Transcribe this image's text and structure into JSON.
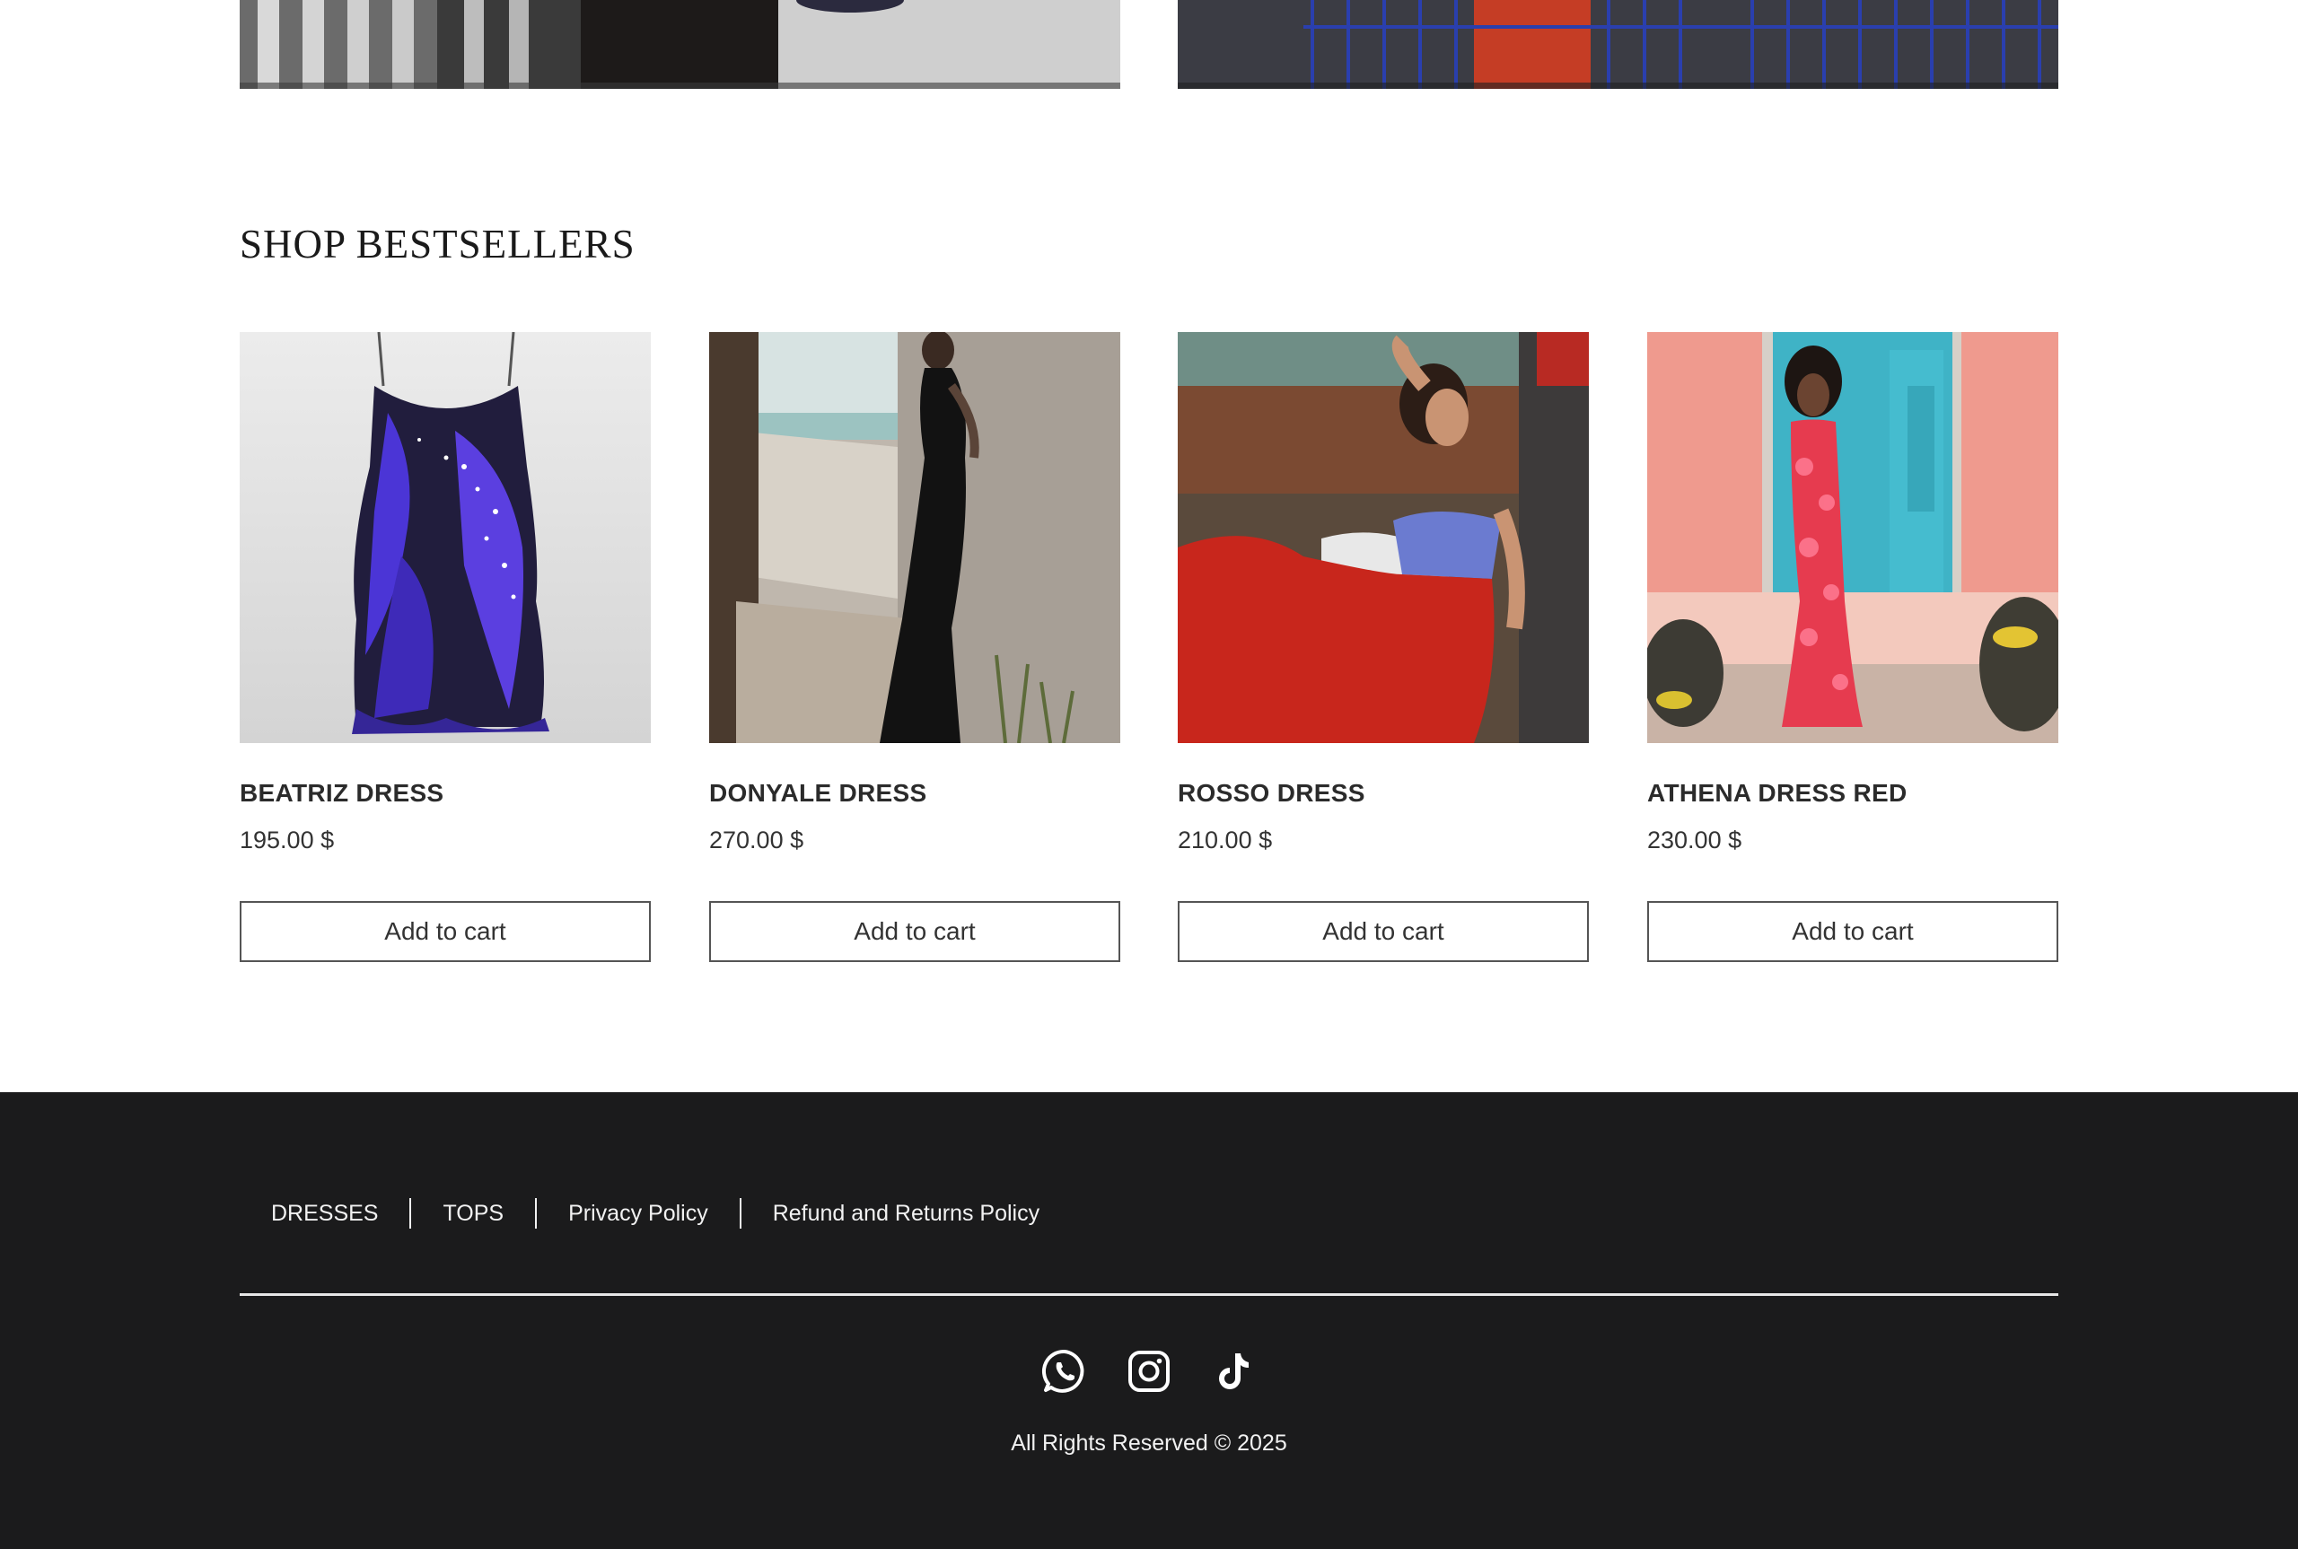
{
  "section": {
    "title": "SHOP BESTSELLERS"
  },
  "products": [
    {
      "name": "BEATRIZ DRESS",
      "price": "195.00 $",
      "cta": "Add to cart",
      "image": "purple-butterfly-print-mini-dress"
    },
    {
      "name": "DONYALE DRESS",
      "price": "270.00 $",
      "cta": "Add to cart",
      "image": "black-halter-maxi-dress-beach"
    },
    {
      "name": "ROSSO DRESS",
      "price": "210.00 $",
      "cta": "Add to cart",
      "image": "red-satin-dress-blue-bodice"
    },
    {
      "name": "ATHENA DRESS RED",
      "price": "230.00 $",
      "cta": "Add to cart",
      "image": "red-floral-slip-dress-blue-door"
    }
  ],
  "footer": {
    "links": [
      "DRESSES",
      "TOPS",
      "Privacy Policy",
      "Refund and Returns Policy"
    ],
    "social": [
      "whatsapp-icon",
      "instagram-icon",
      "tiktok-icon"
    ],
    "copyright": "All Rights Reserved © 2025"
  },
  "colors": {
    "footer_background": "#1b1b1c",
    "page_background": "#ffffff",
    "button_border": "#555555"
  }
}
